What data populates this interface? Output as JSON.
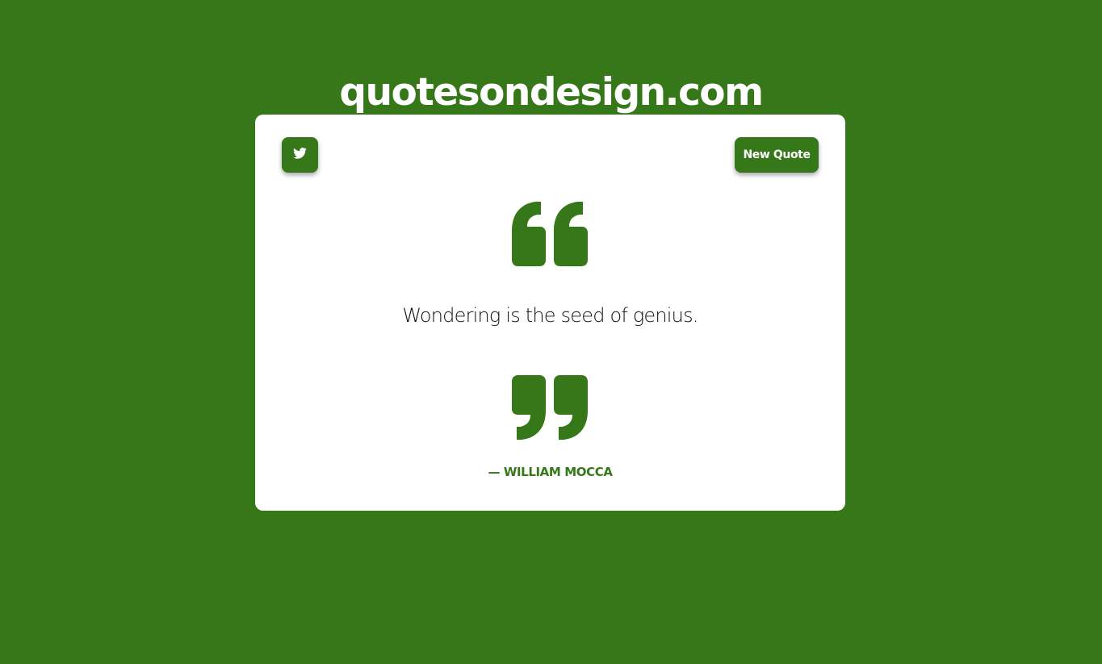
{
  "site": {
    "title": "quotesondesign.com"
  },
  "toolbar": {
    "tweet_icon": "twitter-icon",
    "new_quote_label": "New Quote"
  },
  "quote": {
    "open_icon": "open-quote-icon",
    "close_icon": "close-quote-icon",
    "text": "Wondering is the seed of genius.",
    "author": "— WILLIAM MOCCA"
  },
  "colors": {
    "background": "#367719",
    "card": "#ffffff",
    "accent": "#367719",
    "text": "#111111"
  }
}
